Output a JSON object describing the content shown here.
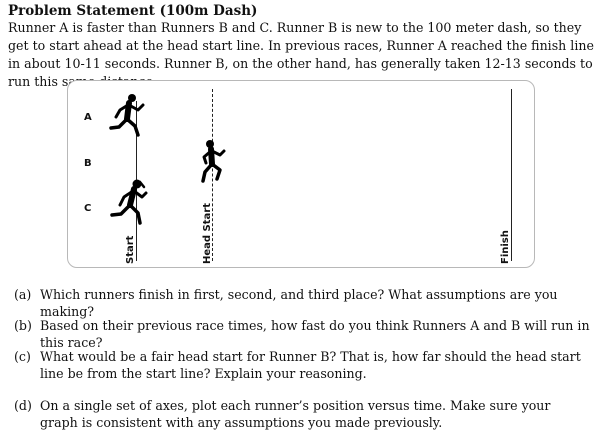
{
  "title": "Problem Statement (100m Dash)",
  "intro": "Runner A is faster than Runners B and C. Runner B is new to the 100 meter dash, so they get to start ahead at the head start line. In previous races, Runner A reached the finish line in about 10-11 seconds. Runner B, on the other hand, has generally taken 12-13 seconds to run this same distance.",
  "figure": {
    "lanes": [
      "A",
      "B",
      "C"
    ],
    "lines": {
      "start": "Start",
      "head_start": "Head Start",
      "finish": "Finish"
    },
    "icons": [
      "runner-a-icon",
      "runner-b-icon",
      "runner-c-icon"
    ]
  },
  "questions": [
    {
      "label": "(a)",
      "text": "Which runners finish in first, second, and third place? What assumptions are you making?"
    },
    {
      "label": "(b)",
      "text": "Based on their previous race times, how fast do you think Runners A and B will run in this race?"
    },
    {
      "label": "(c)",
      "text": "What would be a fair head start for Runner B? That is, how far should the head start line be from the start line? Explain your reasoning."
    },
    {
      "label": "(d)",
      "text": "On a single set of axes, plot each runner’s position versus time. Make sure your graph is consistent with any assumptions you made previously."
    }
  ]
}
